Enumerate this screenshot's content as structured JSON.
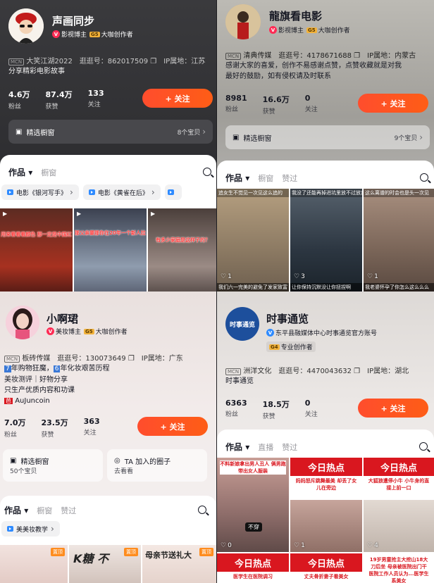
{
  "panels": [
    {
      "name": "声画同步",
      "badges": [
        "影视博主",
        "大咖创作者"
      ],
      "mcn": "大笑江湖2022",
      "id_label": "逛逛号：862017509",
      "ip": "IP属地：江苏",
      "bio": [
        "分享精彩电影故事"
      ],
      "stats": [
        {
          "num": "4.6万",
          "lbl": "粉丝"
        },
        {
          "num": "87.4万",
          "lbl": "获赞"
        },
        {
          "num": "133",
          "lbl": "关注"
        }
      ],
      "follow": "+ 关注",
      "window_label": "精选橱窗",
      "window_count": "8个宝贝",
      "tabs": [
        "作品",
        "橱窗"
      ],
      "chips": [
        "电影《银河写手》",
        "电影《黄雀在后》"
      ],
      "thumbs": [
        {
          "cap": "用来看看看颜色 那一定是中国红",
          "color": "#8c2a1c"
        },
        {
          "cap": "那父亲要那你在20年一个新人拉",
          "color": "#5b6a80"
        },
        {
          "cap": "有多少家庭是这样子的？",
          "color": "#7a6a64"
        }
      ]
    },
    {
      "name": "龍旗看电影",
      "badges": [
        "影视博主",
        "大咖创作者"
      ],
      "mcn": "清典传媒",
      "id_label": "逛逛号：4178671688",
      "ip": "IP属地：内蒙古",
      "bio": [
        "感谢大家的喜爱，创作不易感谢点赞，点赞收藏就是对我",
        "最好的鼓励，如有侵权请及时联系"
      ],
      "stats": [
        {
          "num": "8981",
          "lbl": "粉丝"
        },
        {
          "num": "16.6万",
          "lbl": "获赞"
        },
        {
          "num": "0",
          "lbl": "关注"
        }
      ],
      "follow": "+ 关注",
      "window_label": "精选橱窗",
      "window_count": "9个宝贝",
      "tabs": [
        "作品",
        "橱窗",
        "赞过"
      ],
      "thumbs": [
        {
          "top": "追女生不觉见一次见这么追的",
          "bottom": "我们六一完美的避免了发家致富",
          "likes": "1",
          "color": "#9b8a73"
        },
        {
          "top": "我没了还能再掉进坑里放不过放弃",
          "bottom": "让你保持沉默没让你扭捏啊",
          "likes": "3",
          "color": "#3f4f5e"
        },
        {
          "top": "这么离谱的时会也是头一次见",
          "bottom": "我老婆怀孕了你怎么这么么么",
          "likes": "1",
          "color": "#8a6d60"
        }
      ]
    },
    {
      "name": "小啊珺",
      "badges": [
        "美妆博主",
        "大咖创作者"
      ],
      "mcn": "板砖传媒",
      "id_label": "逛逛号：130073649",
      "ip": "IP属地：广东",
      "bio_tagged": [
        {
          "tag": "7",
          "text": "年购物狂魔，"
        },
        {
          "tag": "6",
          "text": "年化妆艰苦历程"
        }
      ],
      "bio": [
        "美妆测评｜好物分享",
        "只生产优质内容和功课"
      ],
      "link": "AuJuncoin",
      "stats": [
        {
          "num": "7.0万",
          "lbl": "粉丝"
        },
        {
          "num": "23.5万",
          "lbl": "获赞"
        },
        {
          "num": "363",
          "lbl": "关注"
        }
      ],
      "follow": "+ 关注",
      "window_label": "精选橱窗",
      "window_count": "50个宝贝",
      "circle_label": "TA 加入的圈子",
      "circle_sub": "去看看",
      "tabs": [
        "作品",
        "橱窗",
        "赞过"
      ],
      "chips": [
        "美美妆教学"
      ],
      "thumbs": [
        {
          "pin": "置顶",
          "cap": "",
          "color": "#e9d3cd"
        },
        {
          "pin": "置顶",
          "cap": "K糖 不 ",
          "color": "#d6c7c0"
        },
        {
          "pin": "置顶",
          "cap": "母亲节送礼大",
          "color": "#eadcd6"
        }
      ]
    },
    {
      "name": "时事通览",
      "badge_line": "东平县融媒体中心时事通览官方账号",
      "level_label": "专业创作者",
      "mcn": "洲洋文化",
      "id_label": "逛逛号：4470043632",
      "ip": "IP属地：湖北",
      "bio": [
        "时事通览"
      ],
      "stats": [
        {
          "num": "6363",
          "lbl": "粉丝"
        },
        {
          "num": "18.5万",
          "lbl": "获赞"
        },
        {
          "num": "0",
          "lbl": "关注"
        }
      ],
      "follow": "+ 关注",
      "tabs": [
        "作品",
        "直播",
        "赞过"
      ],
      "logo_text": "时事通览",
      "thumbs": [
        {
          "head": "",
          "sub": "不料新娘拿出男人丑人 俩男跑带出女人服装",
          "likes": "0",
          "color": "#a88d86",
          "pill": "不穿"
        },
        {
          "head": "今日热点",
          "sub": "妈妈怒斥跳舞最美 却丢了女儿在旁边",
          "likes": "1",
          "color": "#c5a59b"
        },
        {
          "head": "今日热点",
          "sub": "大狐狼遭停小牛 小牛身的直接上前一口",
          "likes": "4",
          "color": "#d7cfc8"
        }
      ],
      "thumbs2": [
        {
          "head": "今日热点",
          "sub": "医学生在医院调习"
        },
        {
          "head": "今日热点",
          "sub": "丈夫骨折妻子看美女"
        },
        {
          "head": "",
          "sub": "19岁男童抢主大挖山18大刀后坐 母亲被医院出门干 医院工作人员认为...医学生系美女"
        }
      ]
    }
  ],
  "colors": {
    "accent": "#fe2c55",
    "follow": "#ff5b1f",
    "news_red": "#d9171f"
  }
}
